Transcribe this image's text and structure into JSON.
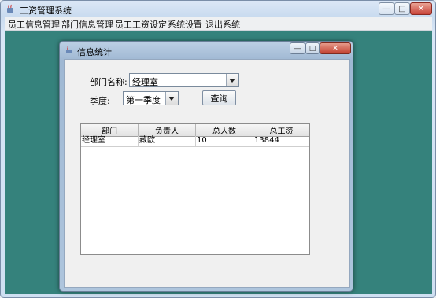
{
  "app": {
    "title": "工资管理系统",
    "controls": [
      "—",
      "□",
      "✕"
    ]
  },
  "menubar": {
    "items": [
      "员工信息管理",
      "部门信息管理",
      "员工工资设定",
      "系统设置",
      "退出系统"
    ]
  },
  "dialog": {
    "title": "信息统计",
    "dept_label": "部门名称:",
    "dept_value": "经理室",
    "season_label": "季度:",
    "season_value": "第一季度",
    "query_button": "查询",
    "table": {
      "headers": [
        "部门",
        "负责人",
        "总人数",
        "总工资"
      ],
      "rows": [
        [
          "经理室",
          "藏欧",
          "10",
          "13844"
        ]
      ]
    }
  },
  "colors": {
    "desktop": "#35827c",
    "frame": "#aec5dd"
  }
}
